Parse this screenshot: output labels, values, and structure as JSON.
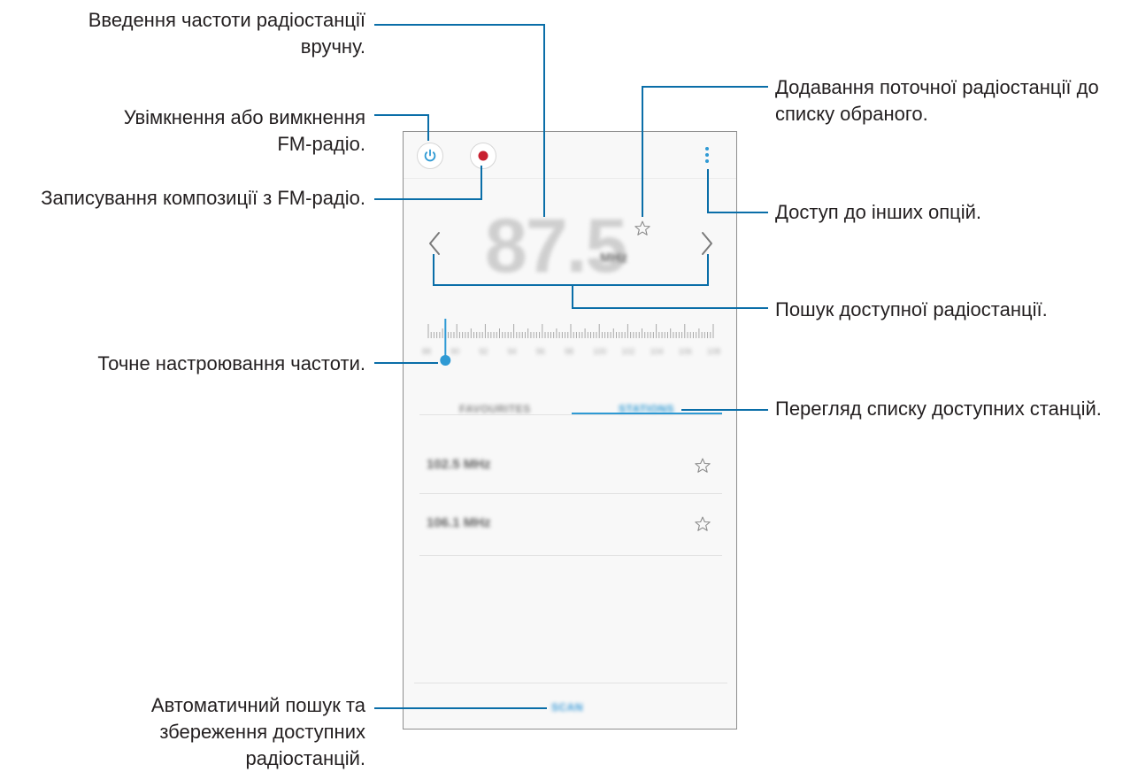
{
  "callouts": {
    "manual_frequency_line1": "Введення частоти радіостанції",
    "manual_frequency_line2": "вручну.",
    "power_line1": "Увімкнення або вимкнення",
    "power_line2": "FM-радіо.",
    "record": "Записування композиції з FM-радіо.",
    "fine_tune": "Точне настроювання частоти.",
    "auto_scan_line1": "Автоматичний пошук та",
    "auto_scan_line2": "збереження доступних",
    "auto_scan_line3": "радіостанцій.",
    "favorite_line1": "Додавання поточної радіостанції до",
    "favorite_line2": "списку обраного.",
    "more_options": "Доступ до інших опцій.",
    "search_station": "Пошук доступної радіостанції.",
    "station_list": "Перегляд списку доступних станцій."
  },
  "radio": {
    "frequency": "87.5",
    "unit": "MHz",
    "scale_labels": [
      "88",
      "90",
      "92",
      "94",
      "96",
      "98",
      "100",
      "102",
      "104",
      "106",
      "108"
    ],
    "tuner_position": 0.06
  },
  "tabs": {
    "favourites": "FAVOURITES",
    "stations": "STATIONS"
  },
  "stations": [
    {
      "label": "102.5 MHz"
    },
    {
      "label": "106.1 MHz"
    }
  ],
  "scan_label": "SCAN",
  "colors": {
    "accent": "#2f9ad4",
    "callout_line": "#0a6ea8",
    "record": "#c8202f"
  }
}
